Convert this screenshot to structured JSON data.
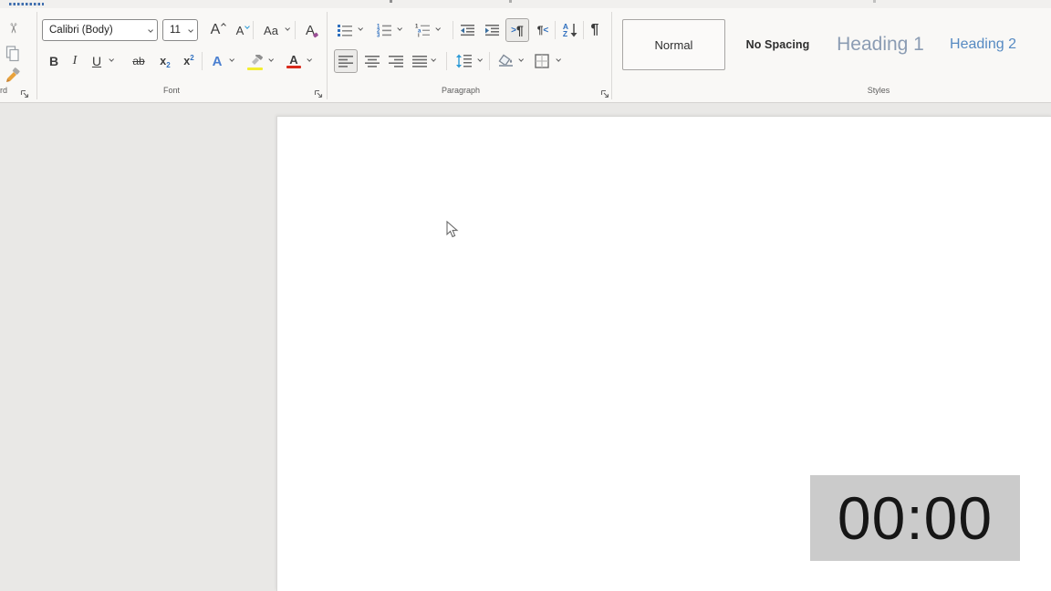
{
  "ribbon": {
    "clipboard": {
      "label_partial": "rd",
      "icons": [
        "cut-icon",
        "copy-icon",
        "format-painter-icon",
        "dialog-launcher-icon"
      ]
    },
    "font": {
      "label": "Font",
      "font_name": "Calibri (Body)",
      "font_size": "11",
      "grow": "A",
      "shrink": "A",
      "change_case": "Aa",
      "clear": "A",
      "bold": "B",
      "italic": "I",
      "underline": "U",
      "strikethrough": "ab",
      "sub_base": "x",
      "sub_mark": "2",
      "sup_base": "x",
      "sup_mark": "2",
      "effects": "A",
      "color_a": "A",
      "icons": [
        "grow-font-icon",
        "shrink-font-icon",
        "change-case-icon",
        "clear-formatting-icon",
        "text-effects-icon",
        "highlight-icon",
        "font-color-icon",
        "dialog-launcher-icon"
      ]
    },
    "paragraph": {
      "label": "Paragraph",
      "numbering": [
        "1",
        "2",
        "3"
      ],
      "multilevel": [
        "1",
        "a",
        "i"
      ],
      "ltr_prefix": ">",
      "pilcrow": "¶",
      "rtl_suffix": "<",
      "sort_a": "A",
      "sort_z": "Z",
      "icons": [
        "bullets-icon",
        "numbering-icon",
        "multilevel-list-icon",
        "decrease-indent-icon",
        "increase-indent-icon",
        "ltr-text-icon",
        "rtl-text-icon",
        "sort-icon",
        "show-marks-icon",
        "align-left-icon",
        "align-center-icon",
        "align-right-icon",
        "justify-icon",
        "line-spacing-icon",
        "shading-icon",
        "borders-icon",
        "dialog-launcher-icon"
      ],
      "selected": [
        "ltr-text",
        "align-left"
      ]
    },
    "styles": {
      "label": "Styles",
      "items": [
        {
          "label": "Normal",
          "selected": true
        },
        {
          "label": "No Spacing",
          "selected": false
        },
        {
          "label": "Heading 1",
          "selected": false
        },
        {
          "label": "Heading 2",
          "selected": false
        }
      ]
    }
  },
  "document": {
    "content": ""
  },
  "timer": {
    "value": "00:00"
  },
  "colors": {
    "accent_blue": "#2f6fbe",
    "highlight_yellow": "#f3ee30",
    "font_color_red": "#d92b1c",
    "clear_format_purple": "#9b4f96",
    "heading1": "#8b9cb3",
    "heading2": "#568ac2",
    "timer_bg": "#cbcbcb",
    "doc_bg": "#e9e8e6",
    "selected_tab_blue": "#3e6dad"
  }
}
